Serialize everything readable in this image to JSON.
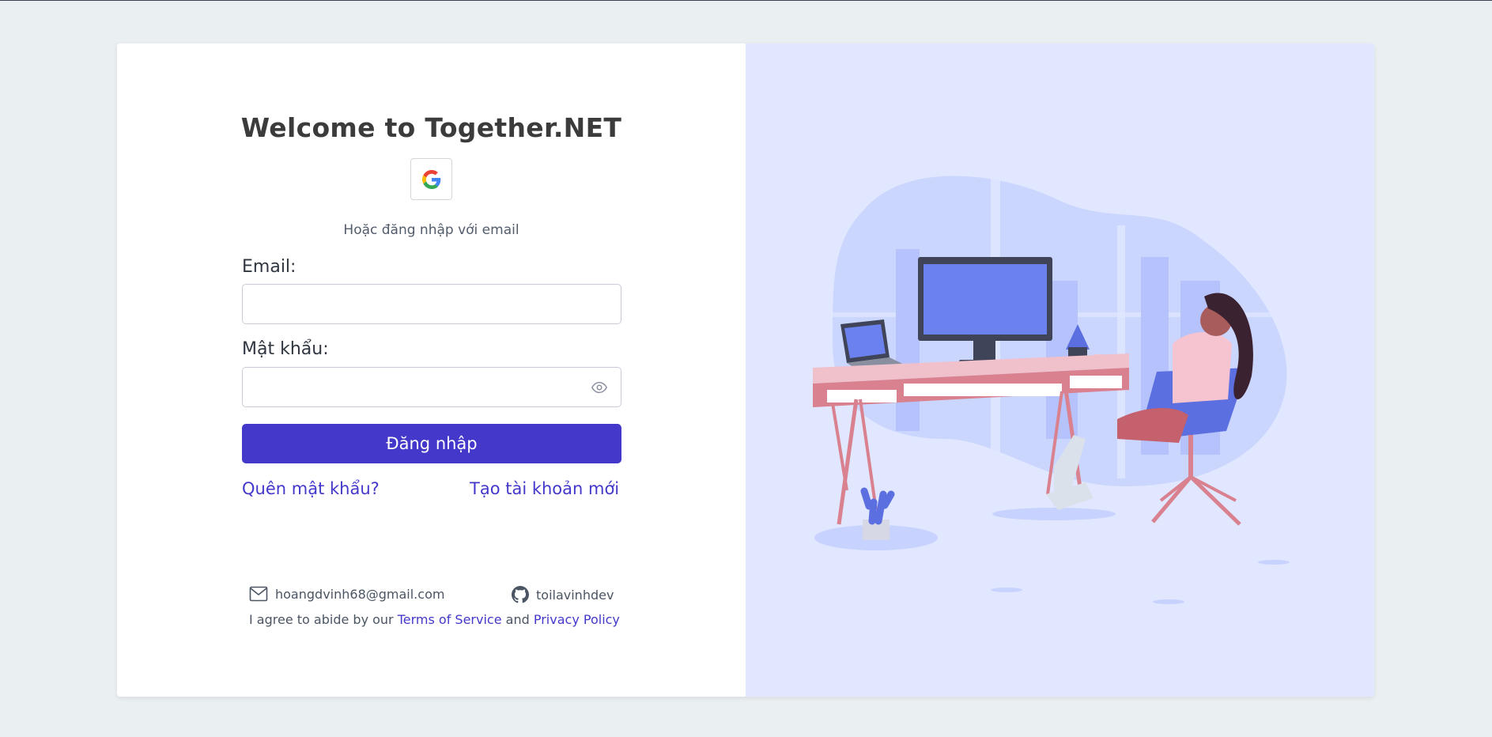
{
  "login": {
    "title": "Welcome to Together.NET",
    "google_icon": "google-icon",
    "or_text": "Hoặc đăng nhập với email",
    "email_label": "Email:",
    "email_value": "",
    "password_label": "Mật khẩu:",
    "password_value": "",
    "eye_icon": "eye-icon",
    "submit_label": "Đăng nhập",
    "forgot_label": "Quên mật khẩu?",
    "register_label": "Tạo tài khoản mới"
  },
  "footer": {
    "email_icon": "mail-icon",
    "email": "hoangdvinh68@gmail.com",
    "github_icon": "github-icon",
    "github": "toilavinhdev",
    "agree_prefix": "I agree to abide by our",
    "terms": "Terms of Service",
    "and": "and",
    "privacy": "Privacy Policy"
  },
  "colors": {
    "page_bg": "#eaeff2",
    "primary": "#4338ca",
    "illustration_bg": "#e0e7ff"
  }
}
